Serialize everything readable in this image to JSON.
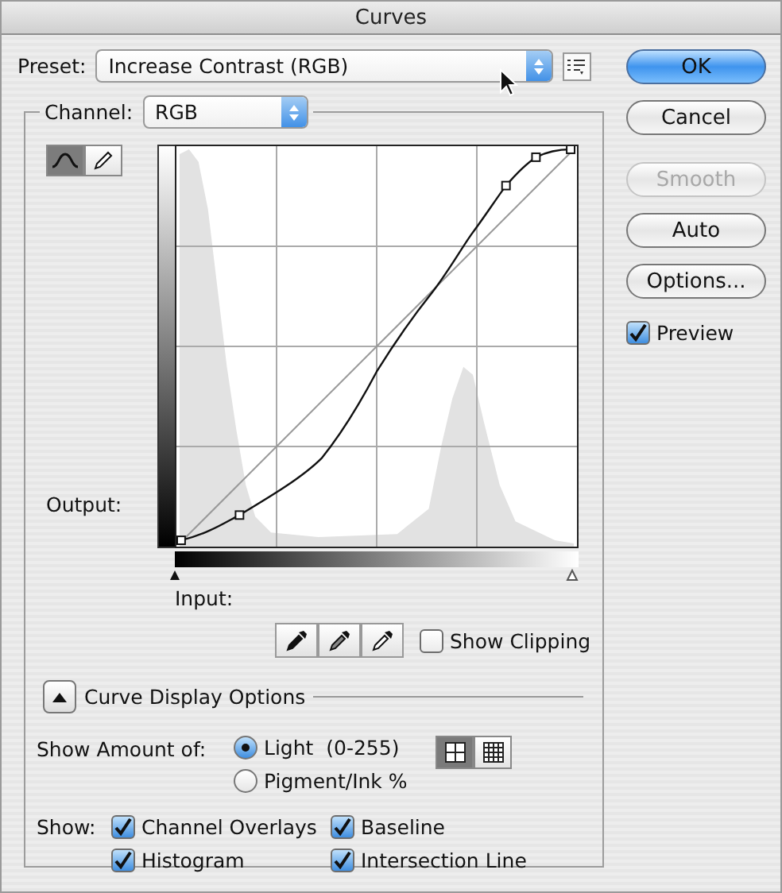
{
  "window": {
    "title": "Curves"
  },
  "preset": {
    "label": "Preset:",
    "value": "Increase Contrast (RGB)"
  },
  "channel": {
    "label": "Channel:",
    "value": "RGB"
  },
  "tools": [
    {
      "kind": "curve",
      "selected": true
    },
    {
      "kind": "pencil",
      "selected": false
    }
  ],
  "graph": {
    "output_label": "Output:",
    "input_label": "Input:"
  },
  "eyedroppers": [
    {
      "kind": "black"
    },
    {
      "kind": "gray"
    },
    {
      "kind": "white"
    }
  ],
  "show_clipping": {
    "label": "Show Clipping",
    "checked": false
  },
  "curve_display_options": {
    "label": "Curve Display Options",
    "expanded": true
  },
  "show_amount": {
    "label": "Show Amount of:",
    "options": [
      {
        "label": "Light  (0-255)",
        "selected": true
      },
      {
        "label": "Pigment/Ink %",
        "selected": false
      }
    ]
  },
  "grid_sizes": [
    {
      "kind": "simple",
      "selected": true
    },
    {
      "kind": "detailed",
      "selected": false
    }
  ],
  "show": {
    "label": "Show:",
    "options": [
      {
        "label": "Channel Overlays",
        "checked": true
      },
      {
        "label": "Baseline",
        "checked": true
      },
      {
        "label": "Histogram",
        "checked": true
      },
      {
        "label": "Intersection Line",
        "checked": true
      }
    ]
  },
  "buttons": [
    {
      "label": "OK",
      "kind": "default",
      "disabled": false
    },
    {
      "label": "Cancel",
      "kind": "normal",
      "disabled": false
    },
    {
      "label": "Smooth",
      "kind": "normal",
      "disabled": true
    },
    {
      "label": "Auto",
      "kind": "normal",
      "disabled": false
    },
    {
      "label": "Options...",
      "kind": "normal",
      "disabled": false
    }
  ],
  "preview": {
    "label": "Preview",
    "checked": true
  }
}
